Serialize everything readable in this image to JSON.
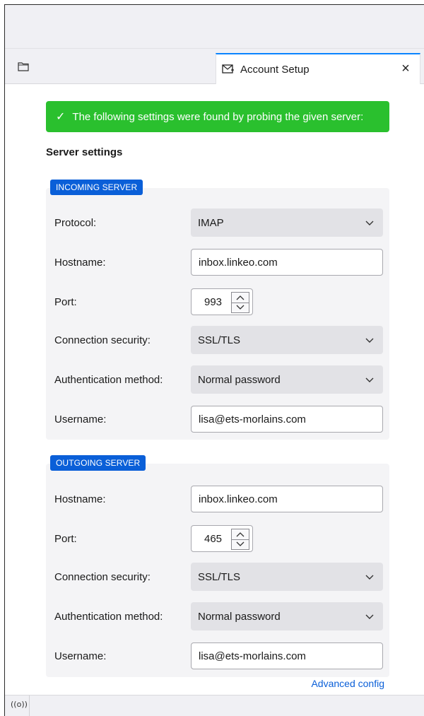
{
  "tab": {
    "label": "Account Setup",
    "close": "×"
  },
  "banner": {
    "check": "✓",
    "text": "The following settings were found by probing the given server:"
  },
  "section_title": "Server settings",
  "incoming": {
    "badge": "INCOMING SERVER",
    "protocol_label": "Protocol:",
    "protocol_value": "IMAP",
    "hostname_label": "Hostname:",
    "hostname_value": "inbox.linkeo.com",
    "port_label": "Port:",
    "port_value": "993",
    "security_label": "Connection security:",
    "security_value": "SSL/TLS",
    "auth_label": "Authentication method:",
    "auth_value": "Normal password",
    "username_label": "Username:",
    "username_value": "lisa@ets-morlains.com"
  },
  "outgoing": {
    "badge": "OUTGOING SERVER",
    "hostname_label": "Hostname:",
    "hostname_value": "inbox.linkeo.com",
    "port_label": "Port:",
    "port_value": "465",
    "security_label": "Connection security:",
    "security_value": "SSL/TLS",
    "auth_label": "Authentication method:",
    "auth_value": "Normal password",
    "username_label": "Username:",
    "username_value": "lisa@ets-morlains.com"
  },
  "advanced_link": "Advanced config",
  "status": {
    "icon": "((o))"
  },
  "colors": {
    "banner": "#2ac02e",
    "badge": "#0a5fd8",
    "accent": "#0a84ff",
    "link": "#0a5fd8"
  }
}
